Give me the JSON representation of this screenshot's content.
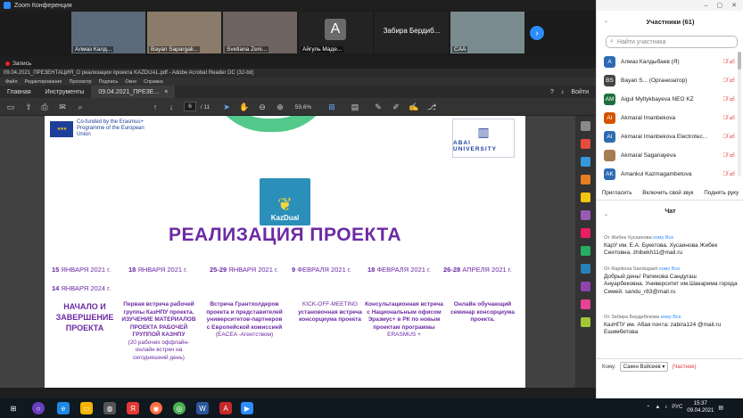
{
  "zoom": {
    "window_title": "Zoom Конференция"
  },
  "gallery": [
    {
      "name": "Алмаз Калд..."
    },
    {
      "name": "Bayan Sapargali..."
    },
    {
      "name": "Svetlana Zeni..."
    },
    {
      "name": "Айгуль Маде...",
      "initial": "А"
    },
    {
      "name": "Забира  Бердиб..."
    },
    {
      "name": "CAA"
    }
  ],
  "recording": {
    "label": "Запись"
  },
  "acrobat": {
    "title": "09.04.2021_ПРЕЗЕНТАЦИЯ_О реализации проекта KAZDUAL.pdf - Adobe Acrobat Reader DC (32-bit)",
    "menu": [
      "Файл",
      "Редактирование",
      "Просмотр",
      "Подпись",
      "Окно",
      "Справка"
    ],
    "tabs": [
      "Главная",
      "Инструменты",
      "09.04.2021_ПРЕЗЕ..."
    ],
    "signin": "Войти",
    "page_current": "6",
    "page_total": "/ 11",
    "zoom": "59,6%"
  },
  "slide": {
    "erasmus_text": "Co-funded by the Erasmus+ Programme of the European Union",
    "abai_text": "ABAI UNIVERSITY",
    "kazdual_label": "KazDual",
    "heading": "РЕАЛИЗАЦИЯ ПРОЕКТА",
    "dates": [
      {
        "num": "15",
        "label": "ЯНВАРЯ 2021 г."
      },
      {
        "num": "18",
        "label": "ЯНВАРЯ 2021 г."
      },
      {
        "num": "25-29",
        "label": "ЯНВАРЯ 2021 г."
      },
      {
        "num": "9",
        "label": "ФЕВРАЛЯ 2021 г."
      },
      {
        "num": "18",
        "label": "ФЕВРАЛЯ 2021 г."
      },
      {
        "num": "26-28",
        "label": "АПРЕЛЯ 2021 г."
      }
    ],
    "date_end": {
      "num": "14",
      "label": "ЯНВАРЯ 2024 г."
    },
    "col1": "НАЧАЛО И ЗАВЕРШЕНИЕ ПРОЕКТА",
    "col2_bold": "Первая встреча рабочей группы КазНПУ проекта. ИЗУЧЕНИЕ МАТЕРИАЛОВ ПРОЕКТА РАБОЧЕЙ ГРУППОЙ КАЗНПУ",
    "col2_normal": "(20 рабочих оффлайн-онлайн встреч на сегодняшний день)",
    "col3_bold": "Встреча Грантхолдеров проекта и представителей университетов-партнеров с Европейской комиссией",
    "col3_normal": "(EACEA -Агентством)",
    "col4_normal": "KICK-OFF-MEETING",
    "col4_bold": "установочная встреча консорциума проекта",
    "col5_bold": "Консультационная встреча с Национальным офисом Эразмус+ в РК по новым проектам программы",
    "col5_normal": "ERASMUS +",
    "col6_bold": "Онлайн обучающий семинар консорциума проекта."
  },
  "participants": {
    "header": "Участники (61)",
    "search_placeholder": "Найти участника",
    "list": [
      {
        "initials": "A",
        "color": "#2d6bb3",
        "name": "Алмаз Калдыбаев (Я)"
      },
      {
        "initials": "BS",
        "color": "#444444",
        "name": "Bayan S... (Организатор)"
      },
      {
        "initials": "AM",
        "color": "#1e6e3c",
        "name": "Aigul Myltykbayeva NEO KZ"
      },
      {
        "initials": "AI",
        "color": "#d35400",
        "name": "Akmaral Imanbekova"
      },
      {
        "initials": "AI",
        "color": "#2d6bb3",
        "name": "Akmaral Imanbekova Electrotec..."
      },
      {
        "initials": "",
        "color": "#a67c52",
        "name": "Akmaral Saganayeva"
      },
      {
        "initials": "AK",
        "color": "#2d6bb3",
        "name": "Amankul Kazmagambetova"
      }
    ],
    "buttons": [
      "Пригласить",
      "Включить свой звук",
      "Поднять руку"
    ]
  },
  "chat": {
    "header": "Чат",
    "messages": [
      {
        "from": "От Жибек Хусаинова",
        "to": "кому Все",
        "text": "КарУ им. Е.А. Букетова. Хусаинова Жибек Сеитовна. zhibekh11@mail.ru"
      },
      {
        "from": "От Rapikova Sandugash",
        "to": "кому Все",
        "text": "Добрый день! Рапикова Сандугаш Ануарбековна. Университет им.Шакарима города Семей. sandu_r83@mail.ru"
      },
      {
        "from": "От Забира Бердибекова",
        "to": "кому Все",
        "text": "КазНПУ им. Абая  почта: zabira124 @mail.ru Ешимбетова"
      }
    ],
    "to_label": "Кому:",
    "to_value": "Сакен Вэйсеев ▾",
    "to_suffix": "(Частное)"
  },
  "taskbar": {
    "lang": "РУС",
    "time": "15:37",
    "date": "09.04.2021"
  }
}
